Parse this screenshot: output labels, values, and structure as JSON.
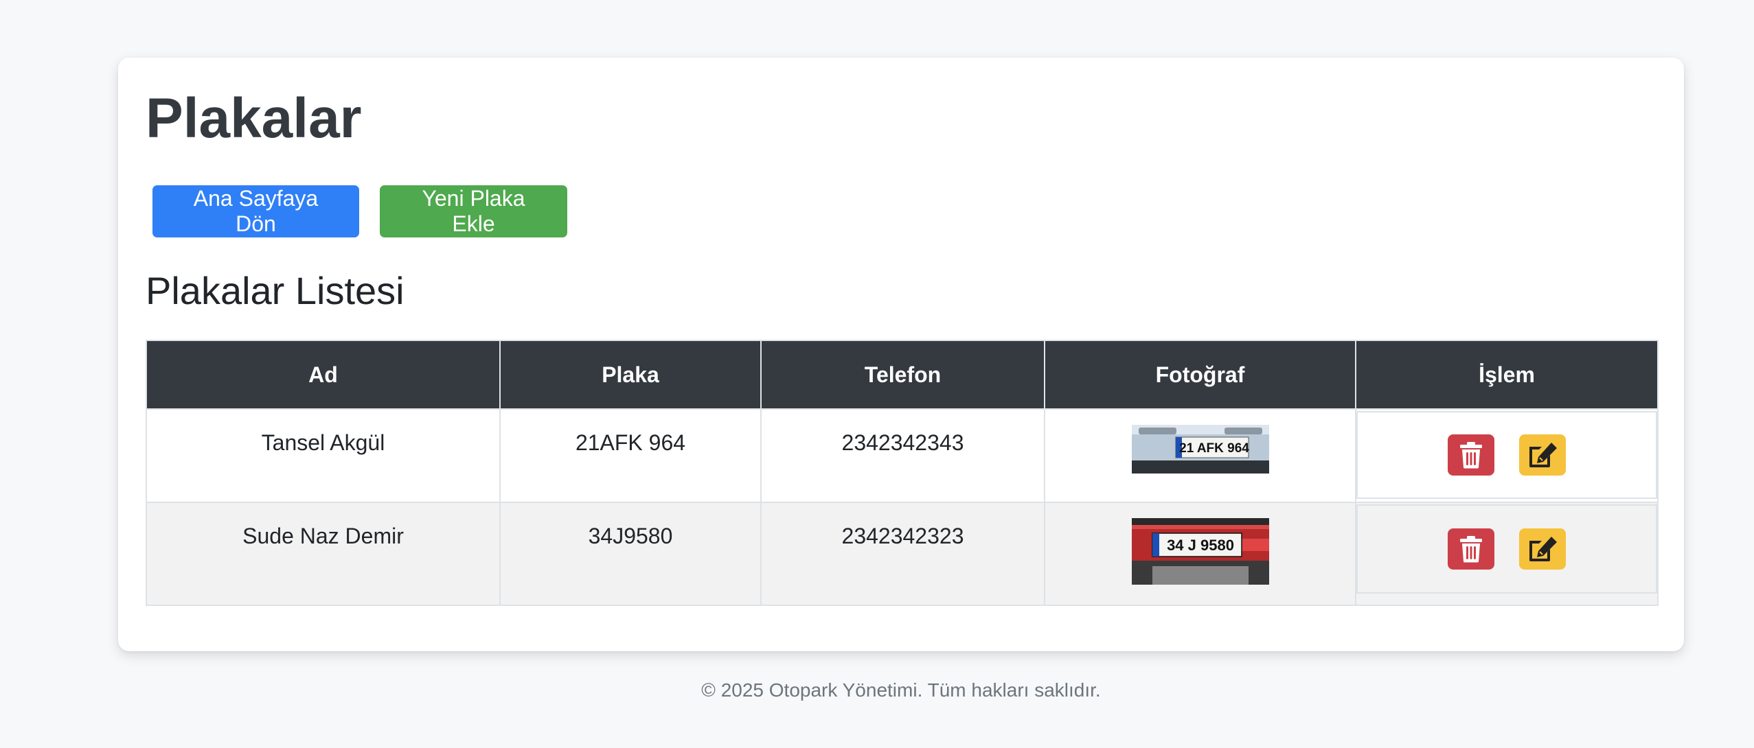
{
  "page": {
    "title": "Plakalar",
    "subtitle": "Plakalar Listesi"
  },
  "buttons": {
    "home_label": "Ana Sayfaya Dön",
    "add_label": "Yeni Plaka Ekle"
  },
  "table": {
    "headers": [
      "Ad",
      "Plaka",
      "Telefon",
      "Fotoğraf",
      "İşlem"
    ],
    "rows": [
      {
        "name": "Tansel Akgül",
        "plate": "21AFK 964",
        "phone": "2342342343",
        "photo_text": "21 AFK 964",
        "photo_kind": "white-car-plate"
      },
      {
        "name": "Sude Naz Demir",
        "plate": "34J9580",
        "phone": "2342342323",
        "photo_text": "34 J 9580",
        "photo_kind": "red-car-plate"
      }
    ]
  },
  "icons": {
    "delete": "trash-icon",
    "edit": "edit-icon"
  },
  "colors": {
    "primary": "#2f80f6",
    "success": "#4fa94e",
    "danger": "#cd3f48",
    "warning": "#f6c13b",
    "header_dark": "#343a40"
  },
  "footer": {
    "text": "© 2025 Otopark Yönetimi. Tüm hakları saklıdır."
  }
}
